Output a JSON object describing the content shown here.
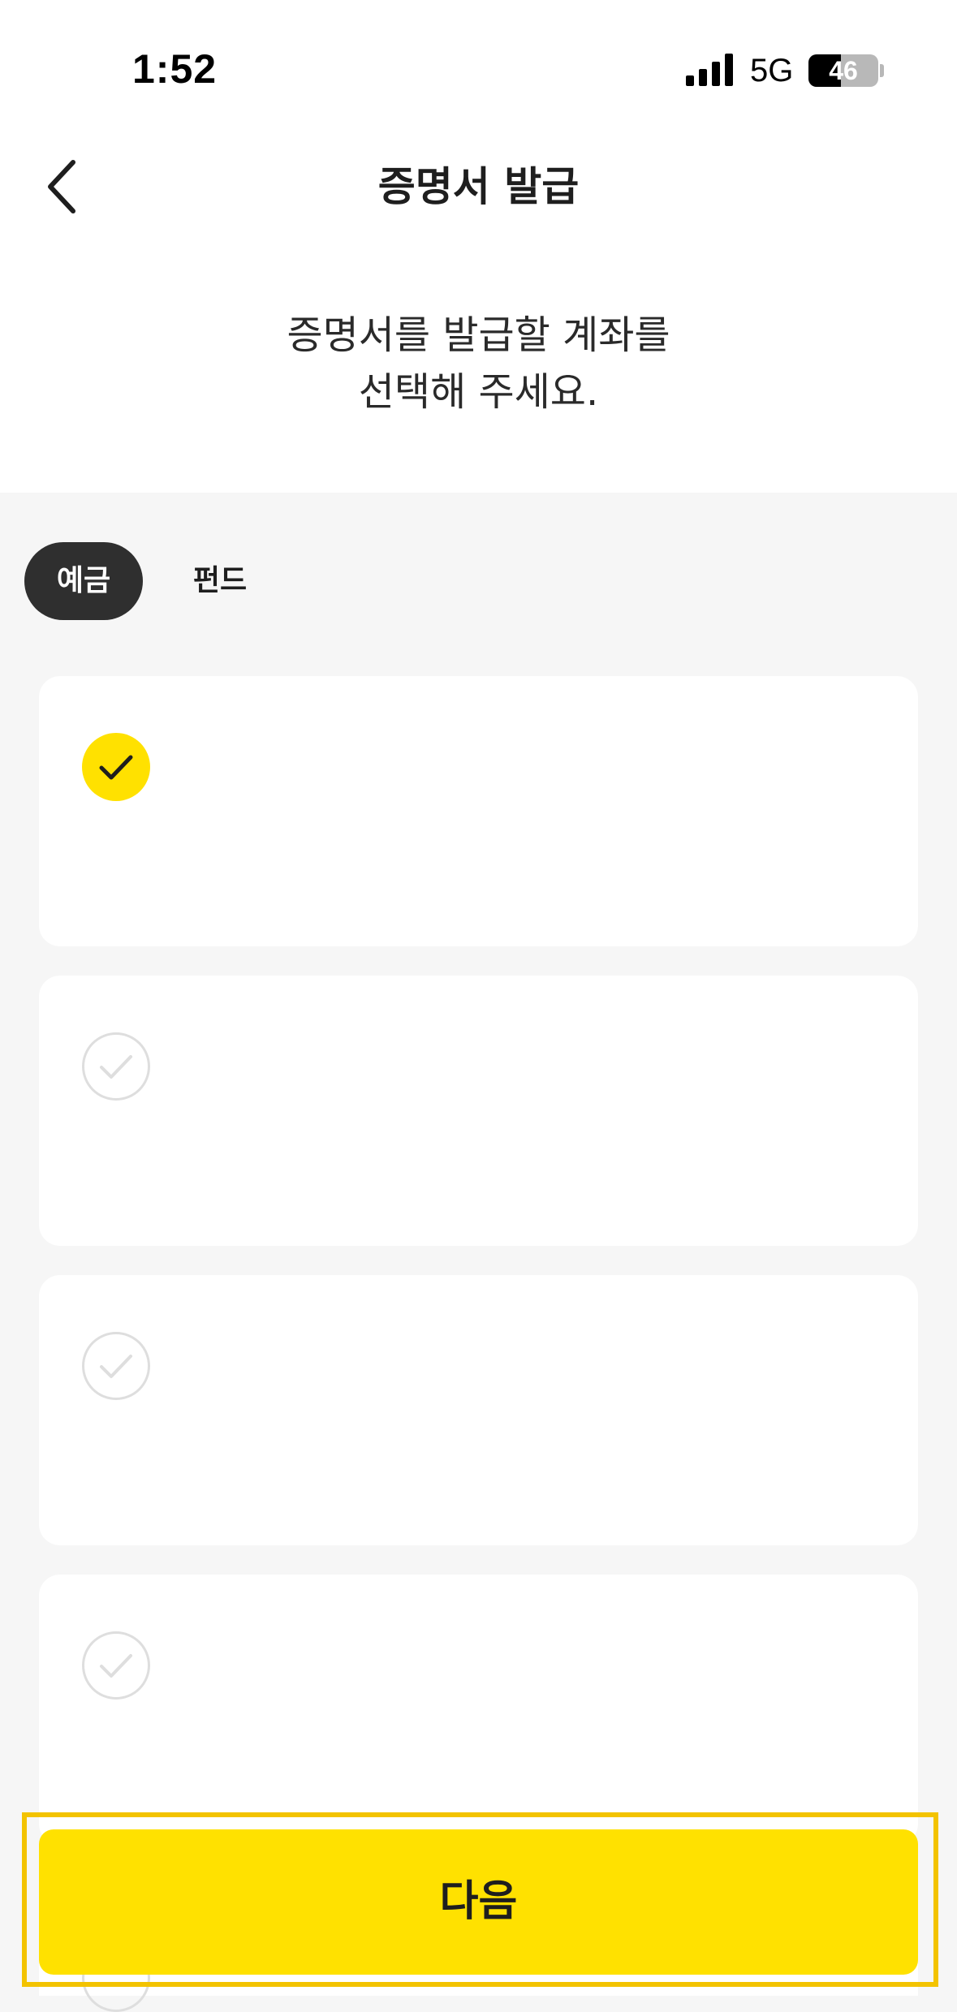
{
  "status_bar": {
    "time": "1:52",
    "network": "5G",
    "battery_level": "46",
    "signal_icon": "cellular-signal-icon",
    "battery_icon": "battery-icon"
  },
  "header": {
    "back_icon": "chevron-left-icon",
    "title": "증명서 발급"
  },
  "instruction": {
    "line1": "증명서를 발급할 계좌를",
    "line2": "선택해 주세요."
  },
  "tabs": [
    {
      "label": "예금",
      "selected": true
    },
    {
      "label": "펀드",
      "selected": false
    }
  ],
  "accounts": [
    {
      "selected": true
    },
    {
      "selected": false
    },
    {
      "selected": false
    },
    {
      "selected": false
    }
  ],
  "colors": {
    "accent": "#ffe100",
    "dark": "#2f2f2f",
    "background": "#f6f6f6"
  },
  "footer": {
    "next_label": "다음"
  }
}
